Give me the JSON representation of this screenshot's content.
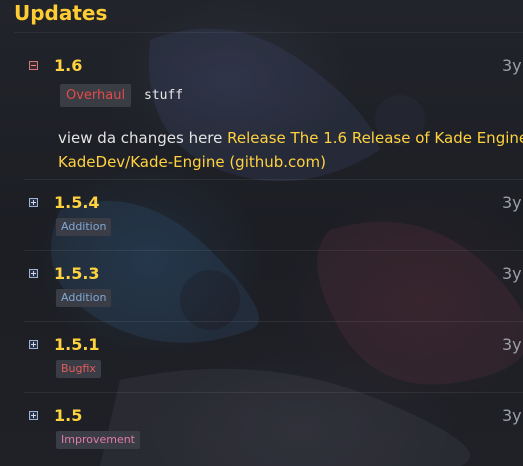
{
  "header": {
    "title": "Updates"
  },
  "updates": [
    {
      "version": "1.6",
      "time": "3y",
      "tag": "Overhaul",
      "subtitle": "stuff",
      "description": {
        "prefix": "view da changes here ",
        "link_line1": "Release The 1.6 Release of Kade Engine ·",
        "link_line2": "KadeDev/Kade-Engine (github.com)"
      }
    },
    {
      "version": "1.5.4",
      "time": "3y",
      "tag": "Addition"
    },
    {
      "version": "1.5.3",
      "time": "3y",
      "tag": "Addition"
    },
    {
      "version": "1.5.1",
      "time": "3y",
      "tag": "Bugfix"
    },
    {
      "version": "1.5",
      "time": "3y",
      "tag": "Improvement"
    }
  ],
  "colors": {
    "accent": "#ffd23f",
    "addition": "#7fa7d6",
    "bugfix": "#e25c5c",
    "improvement": "#e07aa8",
    "overhaul": "#e14b4b"
  },
  "icons": {
    "expanded": "collapse-minus-icon",
    "collapsed": "expand-plus-icon"
  }
}
